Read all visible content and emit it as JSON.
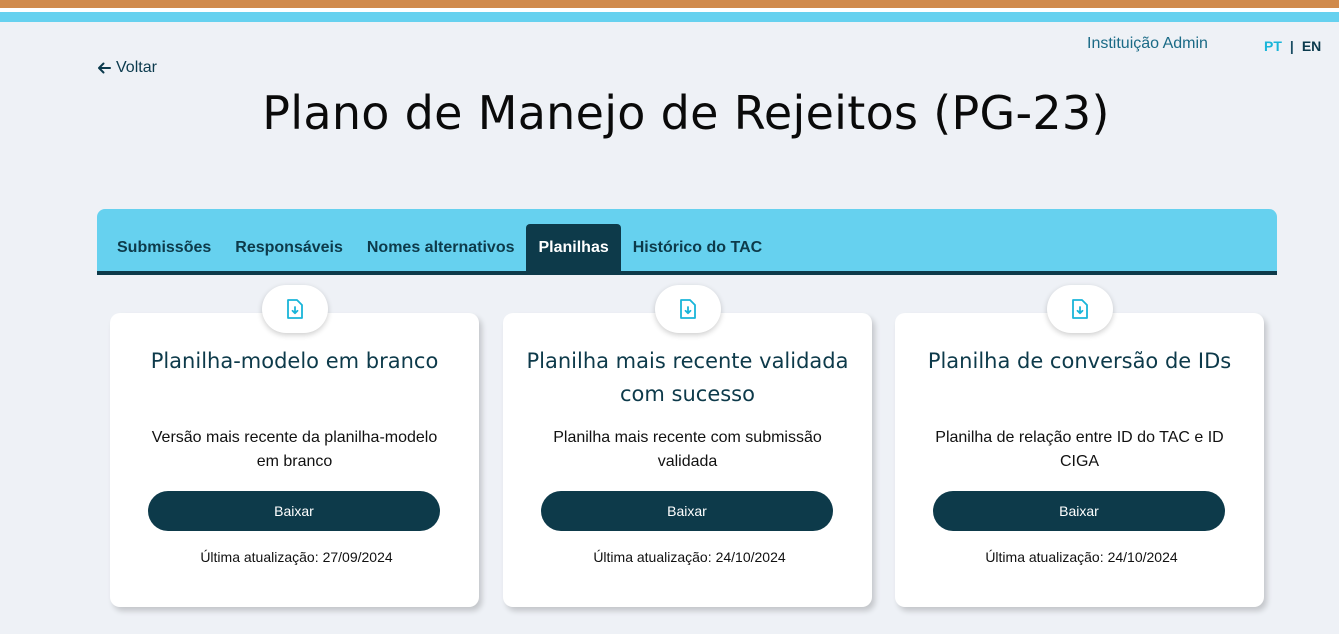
{
  "header": {
    "user_label": "Instituição Admin",
    "lang_pt": "PT",
    "lang_sep": "|",
    "lang_en": "EN",
    "back_label": "Voltar",
    "title": "Plano de Manejo de Rejeitos (PG-23)"
  },
  "tabs": [
    {
      "label": "Submissões",
      "active": false
    },
    {
      "label": "Responsáveis",
      "active": false
    },
    {
      "label": "Nomes alternativos",
      "active": false
    },
    {
      "label": "Planilhas",
      "active": true
    },
    {
      "label": "Histórico do TAC",
      "active": false
    }
  ],
  "cards": [
    {
      "icon": "file-download-icon",
      "title": "Planilha-modelo em branco",
      "description": "Versão mais recente da planilha-modelo em branco",
      "button_label": "Baixar",
      "updated_label": "Última atualização:",
      "updated_date": "27/09/2024"
    },
    {
      "icon": "file-download-icon",
      "title": "Planilha mais recente validada com sucesso",
      "description": "Planilha mais recente com submissão validada",
      "button_label": "Baixar",
      "updated_label": "Última atualização:",
      "updated_date": "24/10/2024"
    },
    {
      "icon": "file-download-icon",
      "title": "Planilha de conversão de IDs",
      "description": "Planilha de relação entre ID do TAC e ID CIGA",
      "button_label": "Baixar",
      "updated_label": "Última atualização:",
      "updated_date": "24/10/2024"
    }
  ],
  "colors": {
    "stripe_orange": "#d08a4c",
    "stripe_blue": "#66d1ef",
    "dark_teal": "#0d3a4a",
    "accent_cyan": "#19b5d9",
    "background": "#eef1f6"
  }
}
